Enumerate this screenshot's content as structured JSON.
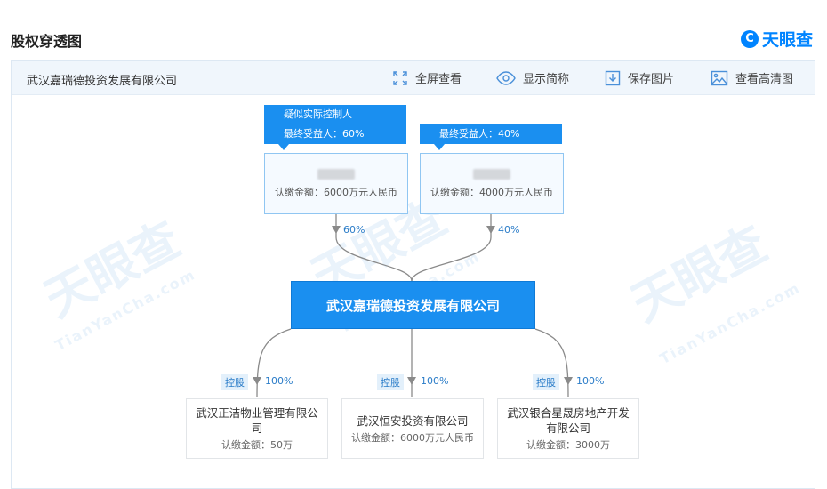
{
  "page": {
    "title": "股权穿透图",
    "brand": "天眼查",
    "brand_mark": "C"
  },
  "toolbar": {
    "company": "武汉嘉瑞德投资发展有限公司",
    "fullscreen": "全屏查看",
    "show_short": "显示简称",
    "save_image": "保存图片",
    "view_hd": "查看高清图"
  },
  "watermark": {
    "mark": "天眼查",
    "url": "TianYanCha.com"
  },
  "holders": [
    {
      "tag_lines": [
        "疑似实际控制人",
        "最终受益人：60%"
      ],
      "amount": "认缴金额：6000万元人民币",
      "percent": "60%"
    },
    {
      "tag_lines": [
        "最终受益人：40%"
      ],
      "amount": "认缴金额：4000万元人民币",
      "percent": "40%"
    }
  ],
  "center": {
    "name": "武汉嘉瑞德投资发展有限公司"
  },
  "subsidiaries": [
    {
      "tag": "控股",
      "percent": "100%",
      "name": "武汉正洁物业管理有限公司",
      "amount": "认缴金额：50万"
    },
    {
      "tag": "控股",
      "percent": "100%",
      "name": "武汉恒安投资有限公司",
      "amount": "认缴金额：6000万元人民币"
    },
    {
      "tag": "控股",
      "percent": "100%",
      "name": "武汉银合星晟房地产开发有限公司",
      "amount": "认缴金额：3000万"
    }
  ]
}
